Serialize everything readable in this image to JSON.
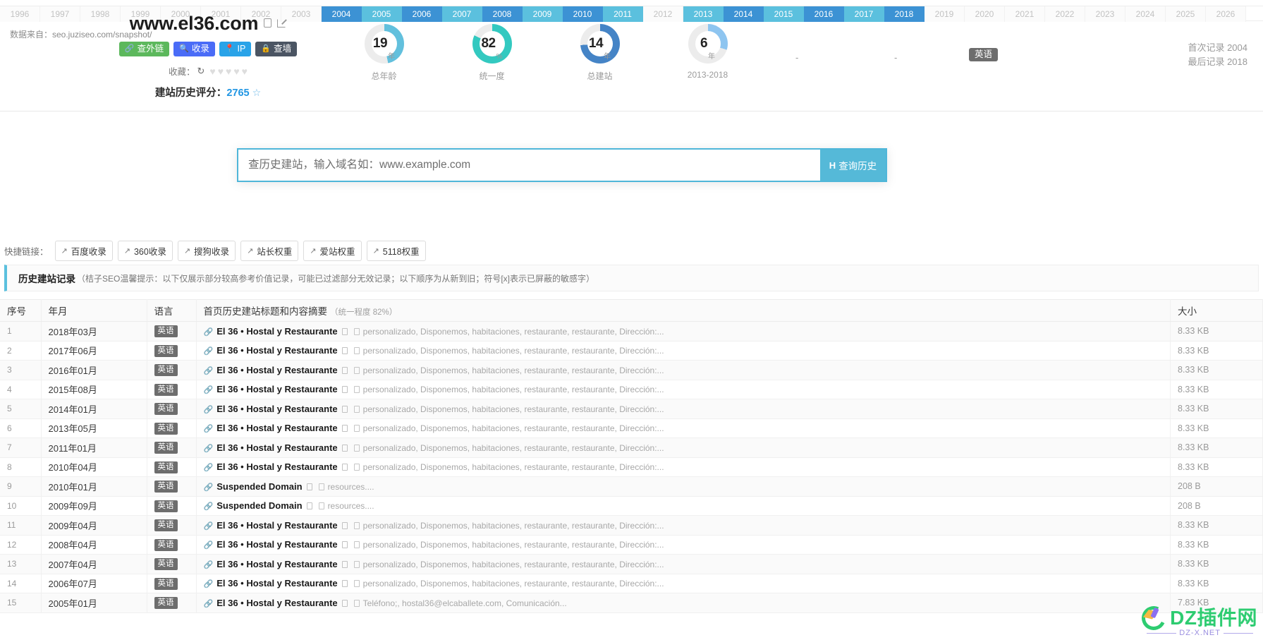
{
  "header": {
    "domain": "www.el36.com",
    "copy_icon": "copy-icon",
    "external_icon": "external-link-icon",
    "buttons": [
      {
        "label": "查外链",
        "icon": "link-icon",
        "color": "#5cb85c"
      },
      {
        "label": "收录",
        "icon": "search-icon",
        "color": "#4a6cf7"
      },
      {
        "label": "IP",
        "icon": "pin-icon",
        "color": "#29a3e8"
      },
      {
        "label": "查墙",
        "icon": "lock-icon",
        "color": "#4b5563"
      }
    ],
    "favorite_label": "收藏：",
    "favorite_refresh_icon": "refresh-icon",
    "hearts": 5,
    "hearts_filled": 0,
    "score_label": "建站历史评分：",
    "score_value": "2765",
    "score_star_icon": "star-outline-icon",
    "lang_chip": "英语",
    "dash_1": "-",
    "dash_2": "-",
    "first_record": "首次记录 2004",
    "last_record": "最后记录 2018"
  },
  "donuts": [
    {
      "value": "19",
      "unit": "年",
      "label": "总年龄",
      "percent": 47,
      "color": "#62c0dd"
    },
    {
      "value": "82",
      "unit": "%",
      "label": "统一度",
      "percent": 82,
      "color": "#33c9c0"
    },
    {
      "value": "14",
      "unit": "年",
      "label": "总建站",
      "percent": 74,
      "color": "#4584c6"
    },
    {
      "value": "6",
      "unit": "年",
      "label": "2013-2018",
      "percent": 30,
      "color": "#8ec5f0"
    }
  ],
  "timeline": {
    "years": [
      {
        "year": "1996",
        "state": "off"
      },
      {
        "year": "1997",
        "state": "off"
      },
      {
        "year": "1998",
        "state": "off"
      },
      {
        "year": "1999",
        "state": "off"
      },
      {
        "year": "2000",
        "state": "off"
      },
      {
        "year": "2001",
        "state": "off"
      },
      {
        "year": "2002",
        "state": "off"
      },
      {
        "year": "2003",
        "state": "off"
      },
      {
        "year": "2004",
        "state": "dark"
      },
      {
        "year": "2005",
        "state": "light"
      },
      {
        "year": "2006",
        "state": "dark"
      },
      {
        "year": "2007",
        "state": "light"
      },
      {
        "year": "2008",
        "state": "dark"
      },
      {
        "year": "2009",
        "state": "light"
      },
      {
        "year": "2010",
        "state": "dark"
      },
      {
        "year": "2011",
        "state": "light"
      },
      {
        "year": "2012",
        "state": "off"
      },
      {
        "year": "2013",
        "state": "light"
      },
      {
        "year": "2014",
        "state": "dark"
      },
      {
        "year": "2015",
        "state": "light"
      },
      {
        "year": "2016",
        "state": "dark"
      },
      {
        "year": "2017",
        "state": "light"
      },
      {
        "year": "2018",
        "state": "dark"
      },
      {
        "year": "2019",
        "state": "off"
      },
      {
        "year": "2020",
        "state": "off"
      },
      {
        "year": "2021",
        "state": "off"
      },
      {
        "year": "2022",
        "state": "off"
      },
      {
        "year": "2023",
        "state": "off"
      },
      {
        "year": "2024",
        "state": "off"
      },
      {
        "year": "2025",
        "state": "off"
      },
      {
        "year": "2026",
        "state": "off"
      }
    ],
    "colors": {
      "dark": "#3c92d4",
      "light": "#5bc0de"
    }
  },
  "source_note": "数据来自：seo.juziseo.com/snapshot/",
  "search": {
    "placeholder": "查历史建站，输入域名如：www.example.com",
    "value": "",
    "button_label": "查询历史",
    "button_icon": "H"
  },
  "quick_links": {
    "label": "快捷链接：",
    "items": [
      {
        "label": "百度收录",
        "icon": "external-link-icon"
      },
      {
        "label": "360收录",
        "icon": "external-link-icon"
      },
      {
        "label": "搜狗收录",
        "icon": "external-link-icon"
      },
      {
        "label": "站长权重",
        "icon": "external-link-icon"
      },
      {
        "label": "爱站权重",
        "icon": "external-link-icon"
      },
      {
        "label": "5118权重",
        "icon": "external-link-icon"
      }
    ]
  },
  "notice": {
    "title": "历史建站记录",
    "rest": "（桔子SEO温馨提示：以下仅展示部分较高参考价值记录，可能已过滤部分无效记录；以下顺序为从新到旧；符号[x]表示已屏蔽的敏感字）"
  },
  "table": {
    "headers": {
      "idx": "序号",
      "ym": "年月",
      "lang": "语言",
      "title": "首页历史建站标题和内容摘要",
      "title_sub": "（统一程度 82%）",
      "size": "大小"
    },
    "rows": [
      {
        "idx": "1",
        "ym": "2018年03月",
        "lang": "英语",
        "title": "El 36 • Hostal y Restaurante",
        "snippet": "personalizado, Disponemos, habitaciones, restaurante, restaurante, Dirección:...",
        "size": "8.33 KB"
      },
      {
        "idx": "2",
        "ym": "2017年06月",
        "lang": "英语",
        "title": "El 36 • Hostal y Restaurante",
        "snippet": "personalizado, Disponemos, habitaciones, restaurante, restaurante, Dirección:...",
        "size": "8.33 KB"
      },
      {
        "idx": "3",
        "ym": "2016年01月",
        "lang": "英语",
        "title": "El 36 • Hostal y Restaurante",
        "snippet": "personalizado, Disponemos, habitaciones, restaurante, restaurante, Dirección:...",
        "size": "8.33 KB"
      },
      {
        "idx": "4",
        "ym": "2015年08月",
        "lang": "英语",
        "title": "El 36 • Hostal y Restaurante",
        "snippet": "personalizado, Disponemos, habitaciones, restaurante, restaurante, Dirección:...",
        "size": "8.33 KB"
      },
      {
        "idx": "5",
        "ym": "2014年01月",
        "lang": "英语",
        "title": "El 36 • Hostal y Restaurante",
        "snippet": "personalizado, Disponemos, habitaciones, restaurante, restaurante, Dirección:...",
        "size": "8.33 KB"
      },
      {
        "idx": "6",
        "ym": "2013年05月",
        "lang": "英语",
        "title": "El 36 • Hostal y Restaurante",
        "snippet": "personalizado, Disponemos, habitaciones, restaurante, restaurante, Dirección:...",
        "size": "8.33 KB"
      },
      {
        "idx": "7",
        "ym": "2011年01月",
        "lang": "英语",
        "title": "El 36 • Hostal y Restaurante",
        "snippet": "personalizado, Disponemos, habitaciones, restaurante, restaurante, Dirección:...",
        "size": "8.33 KB"
      },
      {
        "idx": "8",
        "ym": "2010年04月",
        "lang": "英语",
        "title": "El 36 • Hostal y Restaurante",
        "snippet": "personalizado, Disponemos, habitaciones, restaurante, restaurante, Dirección:...",
        "size": "8.33 KB"
      },
      {
        "idx": "9",
        "ym": "2010年01月",
        "lang": "英语",
        "title": "Suspended Domain",
        "snippet": "resources....",
        "size": "208 B"
      },
      {
        "idx": "10",
        "ym": "2009年09月",
        "lang": "英语",
        "title": "Suspended Domain",
        "snippet": "resources....",
        "size": "208 B"
      },
      {
        "idx": "11",
        "ym": "2009年04月",
        "lang": "英语",
        "title": "El 36 • Hostal y Restaurante",
        "snippet": "personalizado, Disponemos, habitaciones, restaurante, restaurante, Dirección:...",
        "size": "8.33 KB"
      },
      {
        "idx": "12",
        "ym": "2008年04月",
        "lang": "英语",
        "title": "El 36 • Hostal y Restaurante",
        "snippet": "personalizado, Disponemos, habitaciones, restaurante, restaurante, Dirección:...",
        "size": "8.33 KB"
      },
      {
        "idx": "13",
        "ym": "2007年04月",
        "lang": "英语",
        "title": "El 36 • Hostal y Restaurante",
        "snippet": "personalizado, Disponemos, habitaciones, restaurante, restaurante, Dirección:...",
        "size": "8.33 KB"
      },
      {
        "idx": "14",
        "ym": "2006年07月",
        "lang": "英语",
        "title": "El 36 • Hostal y Restaurante",
        "snippet": "personalizado, Disponemos, habitaciones, restaurante, restaurante, Dirección:...",
        "size": "8.33 KB"
      },
      {
        "idx": "15",
        "ym": "2005年01月",
        "lang": "英语",
        "title": "El 36 • Hostal y Restaurante",
        "snippet": "Teléfono;, hostal36@elcaballete.com, Comunicación...",
        "size": "7.83 KB"
      }
    ]
  },
  "watermark": {
    "text": "DZ插件网",
    "sub": "DZ-X.NET"
  }
}
